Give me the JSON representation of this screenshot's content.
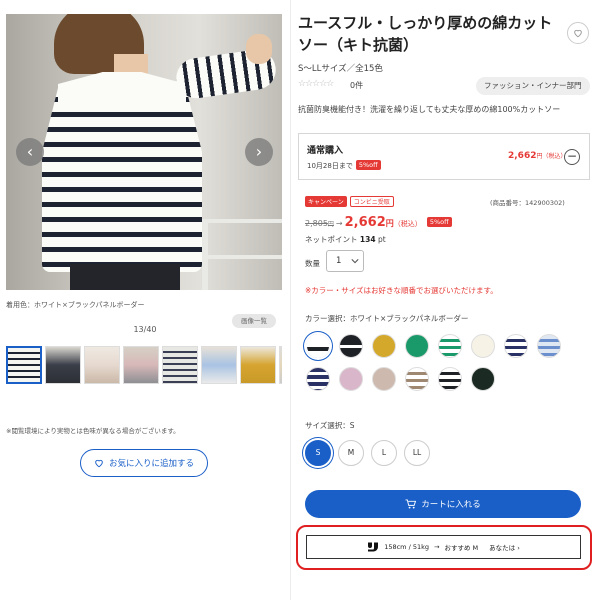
{
  "product": {
    "title": "ユースフル・しっかり厚めの綿カットソー（キト抗菌）",
    "size_info": "S〜LLサイズ／全15色",
    "stars": "☆☆☆☆☆",
    "review_count": "0件",
    "category": "ファッション・インナー部門",
    "description": "抗菌防臭機能付き！洗濯を繰り返しても丈夫な厚めの綿100%カットソー"
  },
  "gallery": {
    "color_caption": "着用色：ホワイト×ブラックパネルボーダー",
    "counter": "13/40",
    "view_all_label": "画像一覧",
    "prev_label": "‹",
    "next_label": "›",
    "notice": "※閲覧環境により実物とは色味が異なる場合がございます。",
    "favorite_label": "お気に入りに追加する",
    "thumbnail_count": 8
  },
  "purchase": {
    "type_label": "通常購入",
    "deadline": "10月28日まで",
    "off_badge": "5%off",
    "price": "2,662",
    "yen": "円（税込）",
    "collapse_label": "−"
  },
  "pricing": {
    "tag_campaign": "キャンペーン",
    "tag_convenience": "コンビニ受取",
    "product_code": "(商品番号：142900302)",
    "old_price": "2,805",
    "old_yen": "円",
    "arrow": "→",
    "new_price": "2,662",
    "new_yen": "円",
    "tax_label": "（税込）",
    "off_badge": "5%off",
    "points_label": "ネットポイント",
    "points_value": "134",
    "points_unit": "pt"
  },
  "quantity": {
    "label": "数量",
    "value": "1"
  },
  "warning": "※カラー・サイズはお好きな順番でお選びいただけます。",
  "color_select": {
    "label": "カラー選択：ホワイト×ブラックパネルボーダー",
    "swatches": [
      {
        "name": "white-black-panel",
        "colors": [
          "#ffffff",
          "#1e2126"
        ]
      },
      {
        "name": "black-white",
        "colors": [
          "#1e2126",
          "#ffffff"
        ]
      },
      {
        "name": "mustard",
        "colors": [
          "#d4a82a"
        ]
      },
      {
        "name": "green",
        "colors": [
          "#1a9a6a"
        ]
      },
      {
        "name": "green-border",
        "colors": [
          "#ffffff",
          "#1a9a6a"
        ]
      },
      {
        "name": "ivory",
        "colors": [
          "#f6f2e6"
        ]
      },
      {
        "name": "navy-border",
        "colors": [
          "#ffffff",
          "#2a3164"
        ]
      },
      {
        "name": "blue-border",
        "colors": [
          "#dfe7f3",
          "#6a8fcc"
        ]
      },
      {
        "name": "navy-white-border",
        "colors": [
          "#2a3164",
          "#ffffff"
        ]
      },
      {
        "name": "pink",
        "colors": [
          "#d9b6c9"
        ]
      },
      {
        "name": "beige",
        "colors": [
          "#cdb9ae"
        ]
      },
      {
        "name": "beige-border",
        "colors": [
          "#ffffff",
          "#9e8872"
        ]
      },
      {
        "name": "black-border",
        "colors": [
          "#ffffff",
          "#1e2126"
        ]
      },
      {
        "name": "dark-green",
        "colors": [
          "#1b2a22"
        ]
      }
    ]
  },
  "size_select": {
    "label": "サイズ選択：S",
    "options": [
      "S",
      "M",
      "L",
      "LL"
    ],
    "selected": "S"
  },
  "cart": {
    "label": "カートに入れる"
  },
  "fit": {
    "measurement": "158cm / 51kg",
    "arrow": "→",
    "recommendation": "おすすめ M",
    "link": "あなたは ›"
  },
  "colors": {
    "brand_blue": "#1a5fc8",
    "sale_red": "#e53935",
    "highlight_red": "#e02020"
  }
}
